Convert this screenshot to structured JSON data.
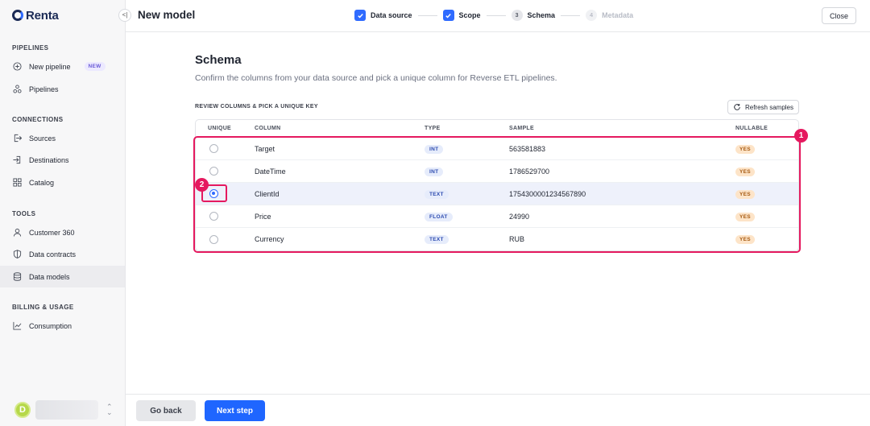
{
  "app": {
    "logo_text": "Renta"
  },
  "sidebar": {
    "sections": [
      {
        "label": "PIPELINES"
      },
      {
        "label": "CONNECTIONS"
      },
      {
        "label": "TOOLS"
      },
      {
        "label": "BILLING & USAGE"
      }
    ],
    "items": [
      {
        "label": "New pipeline",
        "icon": "plus-circle-icon",
        "badge": "NEW"
      },
      {
        "label": "Pipelines",
        "icon": "pipelines-icon"
      },
      {
        "label": "Sources",
        "icon": "sources-icon"
      },
      {
        "label": "Destinations",
        "icon": "destinations-icon"
      },
      {
        "label": "Catalog",
        "icon": "catalog-icon"
      },
      {
        "label": "Customer 360",
        "icon": "user-icon"
      },
      {
        "label": "Data contracts",
        "icon": "shield-icon"
      },
      {
        "label": "Data models",
        "icon": "database-icon",
        "active": true
      },
      {
        "label": "Consumption",
        "icon": "chart-icon"
      }
    ],
    "user": {
      "avatar_letter": "D"
    }
  },
  "header": {
    "title": "New model",
    "steps": [
      {
        "label": "Data source",
        "state": "done"
      },
      {
        "label": "Scope",
        "state": "done"
      },
      {
        "label": "Schema",
        "state": "current",
        "number": "3"
      },
      {
        "label": "Metadata",
        "state": "disabled",
        "number": "4"
      }
    ],
    "close_label": "Close"
  },
  "main": {
    "title": "Schema",
    "subtitle": "Confirm the columns from your data source and pick a unique column for Reverse ETL pipelines.",
    "table_label": "REVIEW COLUMNS & PICK A UNIQUE KEY",
    "refresh_label": "Refresh samples",
    "table": {
      "headers": [
        "UNIQUE",
        "COLUMN",
        "TYPE",
        "SAMPLE",
        "NULLABLE"
      ],
      "rows": [
        {
          "column": "Target",
          "type": "INT",
          "sample": "563581883",
          "nullable": "YES",
          "selected": false
        },
        {
          "column": "DateTime",
          "type": "INT",
          "sample": "1786529700",
          "nullable": "YES",
          "selected": false
        },
        {
          "column": "ClientId",
          "type": "TEXT",
          "sample": "1754300001234567890",
          "nullable": "YES",
          "selected": true
        },
        {
          "column": "Price",
          "type": "FLOAT",
          "sample": "24990",
          "nullable": "YES",
          "selected": false
        },
        {
          "column": "Currency",
          "type": "TEXT",
          "sample": "RUB",
          "nullable": "YES",
          "selected": false
        }
      ]
    }
  },
  "annotations": {
    "marker_1": "1",
    "marker_2": "2",
    "color": "#e5195f"
  },
  "footer": {
    "back_label": "Go back",
    "next_label": "Next step"
  },
  "colors": {
    "accent": "#2f6bff",
    "annotation": "#e5195f"
  }
}
